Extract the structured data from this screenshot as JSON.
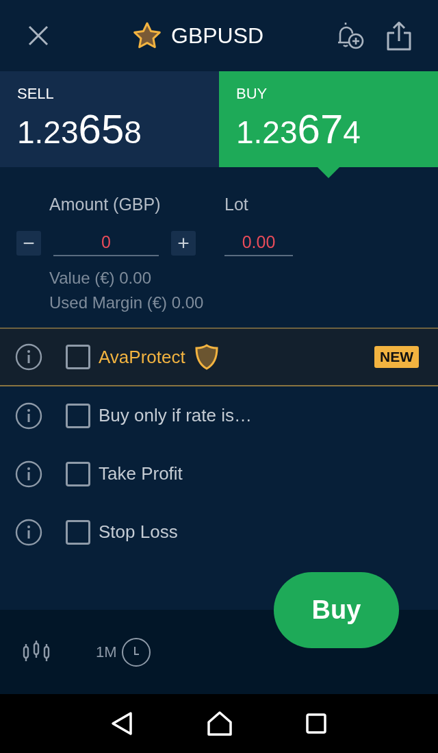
{
  "header": {
    "title": "GBPUSD",
    "favorite": true
  },
  "quotes": [
    {
      "label": "SELL",
      "lead": "1.23",
      "pips": "65",
      "tail": "8",
      "selected": false
    },
    {
      "label": "BUY",
      "lead": "1.23",
      "pips": "67",
      "tail": "4",
      "selected": true
    }
  ],
  "amount": {
    "label": "Amount (GBP)",
    "value": "0",
    "minus": "−",
    "plus": "+"
  },
  "lot": {
    "label": "Lot",
    "value": "0.00"
  },
  "summary": [
    "Value (€) 0.00",
    "Used Margin (€) 0.00"
  ],
  "options": [
    {
      "kind": "protect",
      "label": "AvaProtect",
      "checked": false,
      "badge": "NEW"
    },
    {
      "kind": "plain",
      "label": "Buy only if rate is…",
      "checked": false
    },
    {
      "kind": "plain",
      "label": "Take Profit",
      "checked": false
    },
    {
      "kind": "plain",
      "label": "Stop Loss",
      "checked": false
    }
  ],
  "buy_button": "Buy",
  "timeframe": "1M"
}
